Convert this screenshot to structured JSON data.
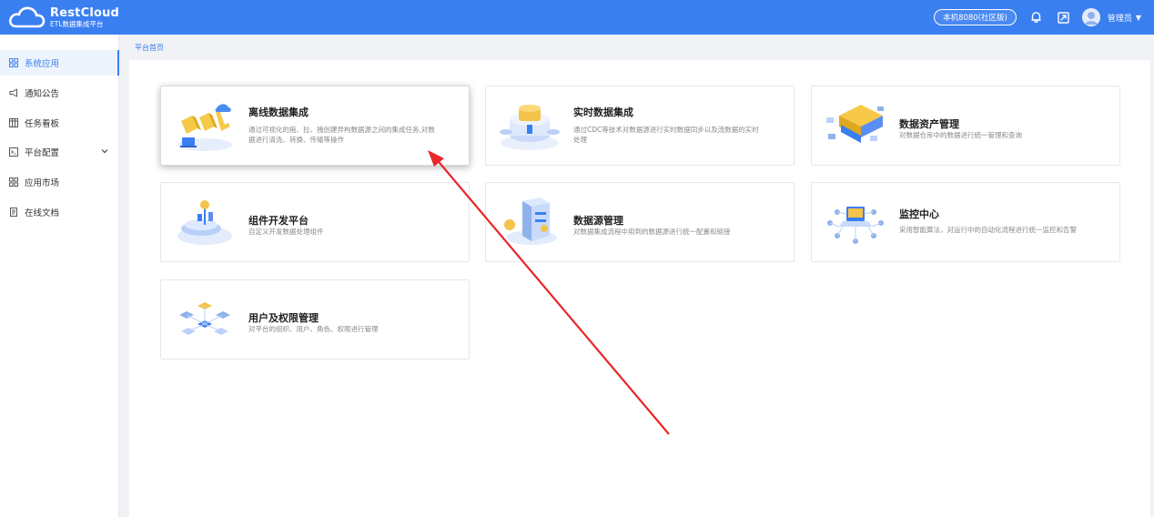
{
  "header": {
    "logo_title": "RestCloud",
    "logo_subtitle": "ETL数据集成平台",
    "env_label": "本机8080(社区版)",
    "user_name": "管理员"
  },
  "colors": {
    "primary": "#3a7ff0",
    "annotation_arrow": "#e8262b"
  },
  "sidebar": {
    "items": [
      {
        "label": "系统应用",
        "icon": "grid-icon",
        "active": true
      },
      {
        "label": "通知公告",
        "icon": "megaphone-icon"
      },
      {
        "label": "任务看板",
        "icon": "board-icon"
      },
      {
        "label": "平台配置",
        "icon": "terminal-icon",
        "has_children": true
      },
      {
        "label": "应用市场",
        "icon": "grid-icon"
      },
      {
        "label": "在线文档",
        "icon": "doc-icon"
      }
    ]
  },
  "breadcrumb": "平台首页",
  "cards": [
    {
      "title": "离线数据集成",
      "desc": "通过可视化的拖、拉、拽创建异构数据源之间的集成任务,对数据进行清洗、转换、传输等操作"
    },
    {
      "title": "实时数据集成",
      "desc": "通过CDC等技术对数据源进行实时数据同步以及流数据的实时处理"
    },
    {
      "title": "数据资产管理",
      "desc": "对数据仓库中的数据进行统一管理和查询"
    },
    {
      "title": "组件开发平台",
      "desc": "自定义开发数据处理组件"
    },
    {
      "title": "数据源管理",
      "desc": "对数据集成流程中用到的数据源进行统一配置和链接"
    },
    {
      "title": "监控中心",
      "desc": "采用智能算法，对运行中的自动化流程进行统一监控和告警"
    },
    {
      "title": "用户及权限管理",
      "desc": "对平台的组织、用户、角色、权限进行管理"
    }
  ]
}
